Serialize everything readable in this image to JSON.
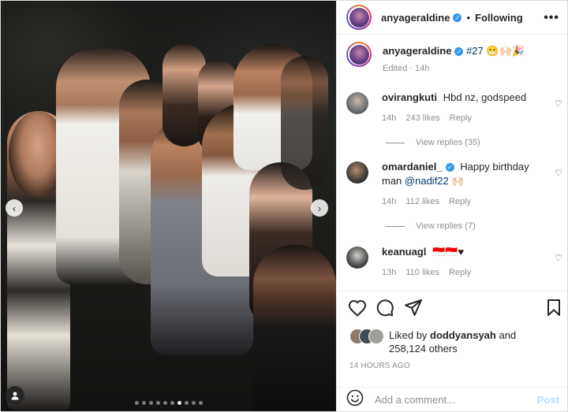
{
  "header": {
    "username": "anyageraldine",
    "separator": "•",
    "follow_status": "Following",
    "more_icon": "•••"
  },
  "caption": {
    "username": "anyageraldine",
    "text": "#27 😁🙌🏻🎉",
    "edited": "Edited",
    "age": "14h"
  },
  "comments": [
    {
      "username": "ovirangkuti",
      "text": "Hbd nz, godspeed",
      "age": "14h",
      "likes": "243 likes",
      "reply": "Reply",
      "view_replies": "View replies (35)",
      "verified": false,
      "avatar_color": "#6b6f73"
    },
    {
      "username": "omardaniel_",
      "text": "Happy birthday man",
      "mention": "@nadif22",
      "emoji": "🙌🏻",
      "age": "14h",
      "likes": "112 likes",
      "reply": "Reply",
      "view_replies": "View replies (7)",
      "verified": true,
      "avatar_color": "#3d3a36"
    },
    {
      "username": "keanuagl",
      "text": "🇮🇩🇮🇩♥",
      "age": "13h",
      "likes": "110 likes",
      "reply": "Reply",
      "verified": false,
      "avatar_color": "#4a4a4a"
    }
  ],
  "likes": {
    "prefix": "Liked by",
    "user": "doddyansyah",
    "joiner": "and",
    "others": "258,124 others"
  },
  "timestamp": "14 HOURS AGO",
  "add_comment": {
    "placeholder": "Add a comment...",
    "post_label": "Post"
  },
  "carousel": {
    "prev_icon": "‹",
    "next_icon": "›",
    "total_slides": 10,
    "active_slide": 6
  },
  "icons": {
    "heart": "heart-icon",
    "comment": "comment-icon",
    "share": "share-icon",
    "save": "bookmark-icon",
    "emoji": "emoji-icon",
    "user_tag": "user-tag-icon"
  },
  "colors": {
    "verified": "#3897f0",
    "link": "#00376b",
    "muted": "#8e8e8e",
    "post_disabled": "#b2dffc"
  }
}
